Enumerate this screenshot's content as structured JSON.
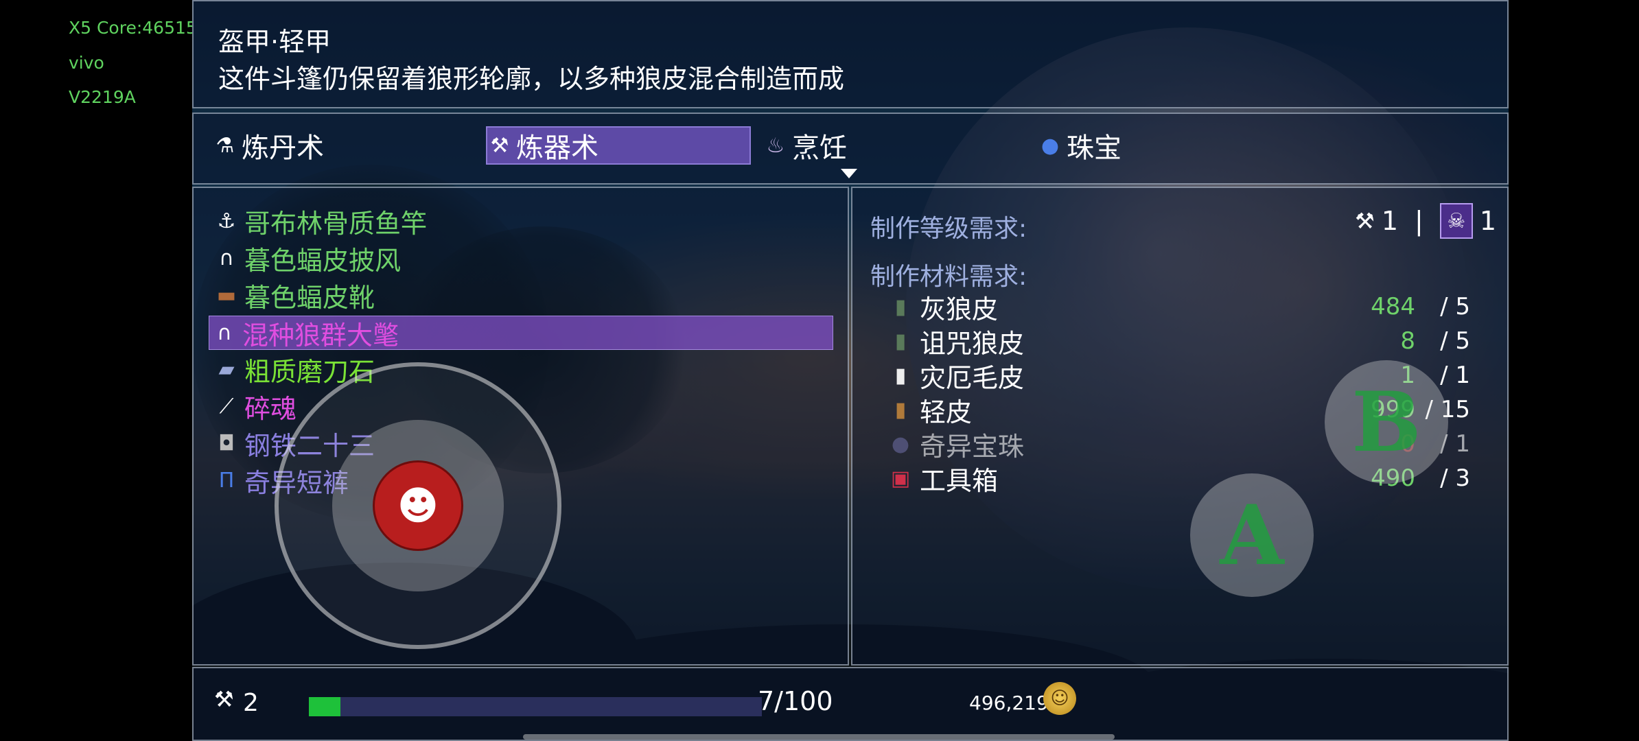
{
  "device": {
    "core": "X5 Core:46515",
    "brand": "vivo",
    "model": "V2219A"
  },
  "item": {
    "type": "盔甲·轻甲",
    "description": "这件斗篷仍保留着狼形轮廓，以多种狼皮混合制造而成"
  },
  "tabs": [
    {
      "label": "炼丹术",
      "icon": "alchemy-pot-icon"
    },
    {
      "label": "炼器术",
      "icon": "anvil-icon",
      "selected": true
    },
    {
      "label": "烹饪",
      "icon": "cooking-pot-icon"
    },
    {
      "label": "珠宝",
      "icon": "blue-gem-icon"
    }
  ],
  "recipes": [
    {
      "name": "哥布林骨质鱼竿",
      "icon": "fishing-rod-icon",
      "color": "#6fd26a"
    },
    {
      "name": "暮色蝠皮披风",
      "icon": "cloak-icon",
      "color": "#6fd26a"
    },
    {
      "name": "暮色蝠皮靴",
      "icon": "boots-icon",
      "color": "#6fd26a"
    },
    {
      "name": "混种狼群大氅",
      "icon": "wolf-cloak-icon",
      "color": "#e04ee0",
      "selected": true
    },
    {
      "name": "粗质磨刀石",
      "icon": "whetstone-icon",
      "color": "#7ae236"
    },
    {
      "name": "碎魂",
      "icon": "axe-icon",
      "color": "#e04ee0"
    },
    {
      "name": "钢铁二十三",
      "icon": "armor-icon",
      "color": "#8a7fe0"
    },
    {
      "name": "奇异短裤",
      "icon": "shorts-icon",
      "color": "#8a7fe0"
    }
  ],
  "detail": {
    "level_label": "制作等级需求:",
    "level_anvil": "1",
    "level_divider": "|",
    "level_skull": "1",
    "materials_label": "制作材料需求:",
    "materials": [
      {
        "name": "灰狼皮",
        "icon": "leather-icon",
        "have": "484",
        "need": "/ 5",
        "have_color": "#6fd26a"
      },
      {
        "name": "诅咒狼皮",
        "icon": "leather-icon",
        "have": "8",
        "need": "/ 5",
        "have_color": "#6fd26a"
      },
      {
        "name": "灾厄毛皮",
        "icon": "white-fur-icon",
        "have": "1",
        "need": "/ 1",
        "have_color": "#6fd26a"
      },
      {
        "name": "轻皮",
        "icon": "brown-leather-icon",
        "have": "999",
        "need": "/ 15",
        "have_color": "#6fd26a"
      },
      {
        "name": "奇异宝珠",
        "icon": "dark-orb-icon",
        "have": "0",
        "need": "/ 1",
        "have_color": "#d03a3a",
        "dim": true
      },
      {
        "name": "工具箱",
        "icon": "toolbox-icon",
        "have": "490",
        "need": "/ 3",
        "have_color": "#6fd26a"
      }
    ]
  },
  "footer": {
    "craft_level": "2",
    "progress_text": "7/100",
    "progress_fraction": 0.07,
    "gold": "496,219"
  },
  "controls": {
    "a_label": "A",
    "b_label": "B"
  }
}
